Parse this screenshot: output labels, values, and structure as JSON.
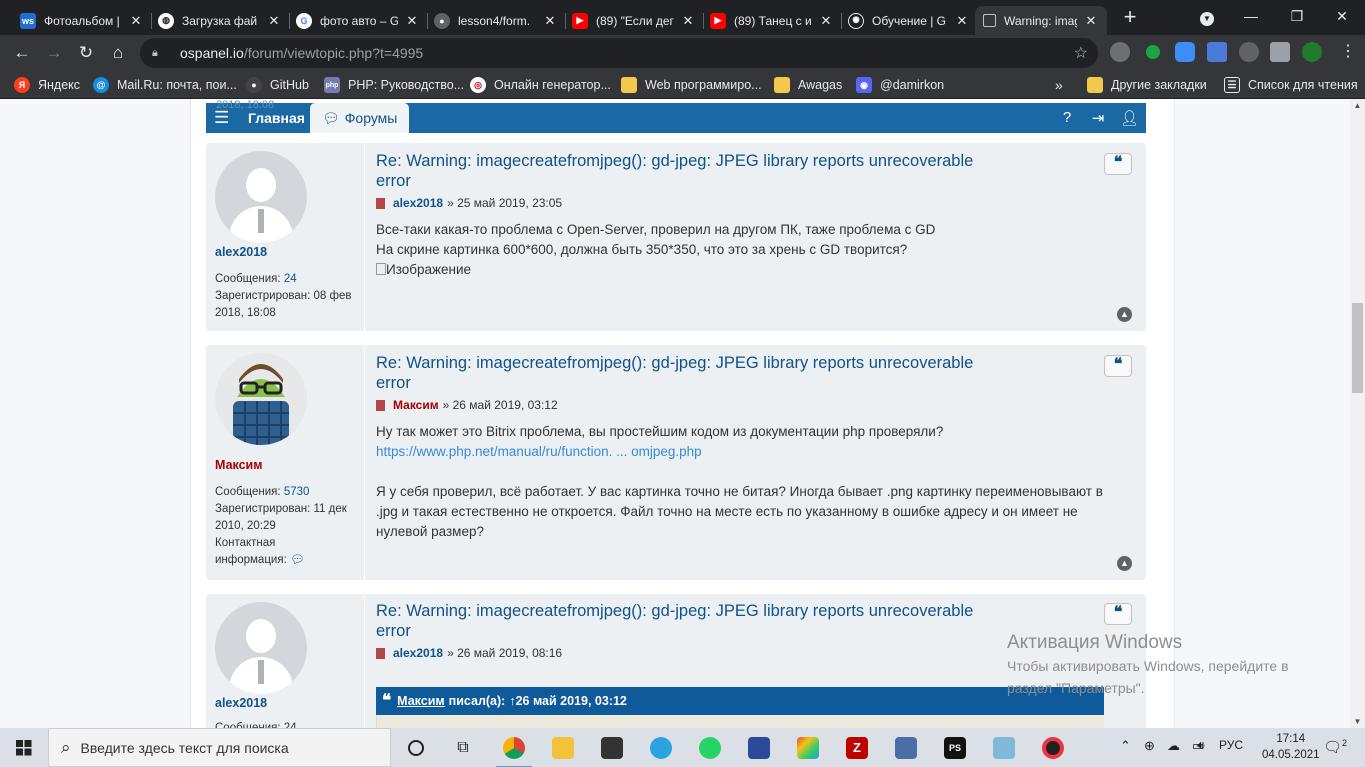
{
  "browser": {
    "tabs": [
      {
        "title": "Фотоальбом | ",
        "icon": "ws-icon",
        "active": false
      },
      {
        "title": "Загрузка фай",
        "icon": "globe-icon",
        "active": false
      },
      {
        "title": "фото авто – G",
        "icon": "google-icon",
        "active": false
      },
      {
        "title": "lesson4/form.",
        "icon": "github-icon",
        "active": false
      },
      {
        "title": "(89) \"Если дег",
        "icon": "youtube-icon",
        "active": false
      },
      {
        "title": "(89) Танец с и",
        "icon": "youtube-icon",
        "active": false
      },
      {
        "title": "Обучение | G",
        "icon": "openai-icon",
        "active": false
      },
      {
        "title": "Warning: imag",
        "icon": "page-icon",
        "active": true
      }
    ],
    "url_domain": "ospanel.io",
    "url_path": "/forum/viewtopic.php?t=4995",
    "bookmarks": [
      {
        "label": "Яндекс",
        "icon": "yandex-icon"
      },
      {
        "label": "Mail.Ru: почта, пои...",
        "icon": "mailru-icon"
      },
      {
        "label": "GitHub",
        "icon": "github-icon"
      },
      {
        "label": "PHP: Руководство...",
        "icon": "php-icon"
      },
      {
        "label": "Онлайн генератор...",
        "icon": "generator-icon"
      },
      {
        "label": "Web программиро...",
        "icon": "folder-icon"
      },
      {
        "label": "Awagas",
        "icon": "folder-icon"
      },
      {
        "label": "@damirkon",
        "icon": "discord-icon"
      },
      {
        "label": "Другие закладки",
        "icon": "folder-icon"
      },
      {
        "label": "Список для чтения",
        "icon": "reading-list-icon"
      }
    ]
  },
  "forum": {
    "nav": {
      "ghost_text": "2018, 18:08",
      "home": "Главная",
      "forums": "Форумы"
    },
    "posts": [
      {
        "title_line1": "Re: Warning: imagecreatefromjpeg(): gd-jpeg: JPEG library reports unrecoverable",
        "title_line2": "error",
        "author": "alex2018",
        "date": "» 25 май 2019, 23:05",
        "content": [
          "Все-таки какая-то проблема с Open-Server, проверил на другом ПК, таже проблема с GD",
          "На скрине картинка 600*600, должна быть 350*350, что это за хрень с GD творится?",
          "Изображение"
        ],
        "messages_label": "Сообщения:",
        "messages_count": "24",
        "registered_line1": "Зарегистрирован: 08 фев",
        "registered_line2": "2018, 18:08"
      },
      {
        "title_line1": "Re: Warning: imagecreatefromjpeg(): gd-jpeg: JPEG library reports unrecoverable",
        "title_line2": "error",
        "author": "Максим",
        "date": "» 26 май 2019, 03:12",
        "content": [
          "Ну так может это Bitrix проблема, вы простейшим кодом из документации php проверяли?",
          "https://www.php.net/manual/ru/function. ... omjpeg.php",
          "Я у себя проверил, всё работает. У вас картинка точно не битая? Иногда бывает .png картинку переименовывают в",
          ".jpg и такая естественно не откроется. Файл точно на месте есть по указанному в ошибке адресу и он имеет не",
          "нулевой размер?"
        ],
        "messages_label": "Сообщения:",
        "messages_count": "5730",
        "registered_line1": "Зарегистрирован: 11 дек",
        "registered_line2": "2010, 20:29",
        "contact_line1": "Контактная",
        "contact_line2": "информация:"
      },
      {
        "title_line1": "Re: Warning: imagecreatefromjpeg(): gd-jpeg: JPEG library reports unrecoverable",
        "title_line2": "error",
        "author": "alex2018",
        "date": "» 26 май 2019, 08:16",
        "quote_author": "Максим",
        "quote_wrote": "писал(а):",
        "quote_date": "↑26 май 2019, 03:12",
        "messages_partial": "Сообщения: 24"
      }
    ]
  },
  "activation": {
    "title": "Активация Windows",
    "line1": "Чтобы активировать Windows, перейдите в",
    "line2": "раздел \"Параметры\"."
  },
  "taskbar": {
    "search_placeholder": "Введите здесь текст для поиска",
    "language": "РУС",
    "time": "17:14",
    "date": "04.05.2021",
    "notifications": "2"
  },
  "colors": {
    "forum_link": "#105289",
    "navbar": "#1a69a4",
    "post_bg": "#ecf0f3",
    "author_red": "#aa0000"
  }
}
